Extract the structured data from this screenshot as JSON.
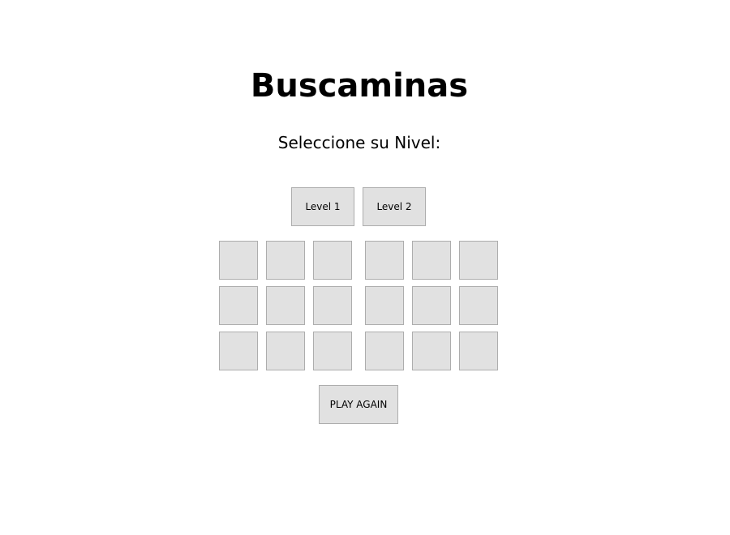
{
  "header": {
    "title": "Buscaminas",
    "subtitle": "Seleccione su Nivel:"
  },
  "levels": {
    "level1_label": "Level 1",
    "level2_label": "Level 2"
  },
  "boards": {
    "count": 2,
    "rows": 3,
    "cols": 3,
    "cell_state": "unrevealed"
  },
  "controls": {
    "play_again_label": "PLAY AGAIN"
  },
  "colors": {
    "button_background": "#e1e1e1",
    "button_border": "#adadad",
    "page_background": "#ffffff"
  }
}
